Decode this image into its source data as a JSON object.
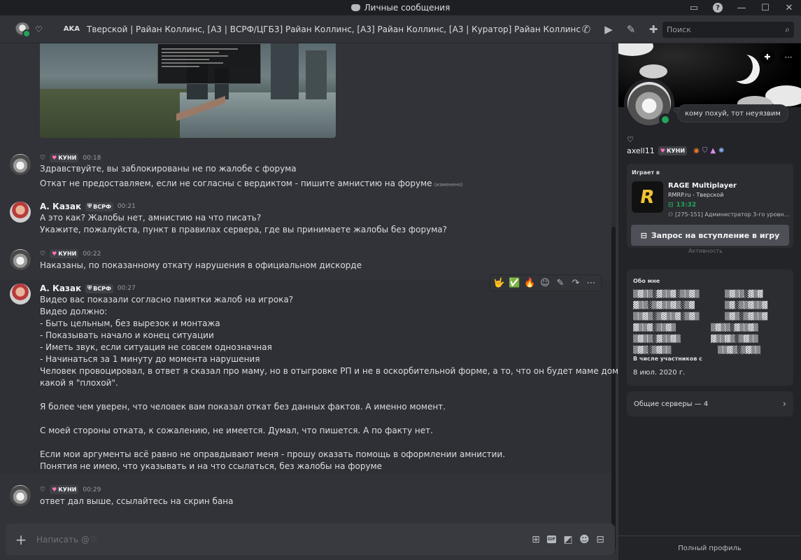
{
  "window": {
    "title": "Личные сообщения",
    "controls": [
      "inbox-icon",
      "help-icon",
      "minimize",
      "maximize",
      "close"
    ]
  },
  "header": {
    "heart": "♡",
    "aka_label": "AKA",
    "nicknames": "Тверской | Райан Коллинс, [А3 | ВСРФ/ЦГБ3] Райан Коллинс, [А3] Райан Коллинс, [А3 | Куратор] Райан Коллинс",
    "tools": [
      "phone-icon",
      "video-icon",
      "pin-icon",
      "add-member-icon",
      "profile-toggle-icon"
    ],
    "search_placeholder": "Поиск"
  },
  "messages": [
    {
      "author": "",
      "heart": "♡",
      "tag": "КУНИ",
      "time": "00:18",
      "lines": [
        "Здравствуйте, вы заблокированы не по жалобе с форума",
        "Откат не предоставляем, если не согласны с вердиктом - пишите амнистию на форуме"
      ],
      "edited": "(изменено)"
    },
    {
      "author": "А. Казак",
      "tag": "ВСРФ",
      "time": "00:21",
      "lines": [
        "А это как? Жалобы нет, амнистию на что писать?",
        "Укажите, пожалуйста, пункт в правилах сервера, где вы принимаете жалобы без форума?"
      ]
    },
    {
      "author": "",
      "heart": "♡",
      "tag": "КУНИ",
      "time": "00:22",
      "lines": [
        "Наказаны, по показанному откату нарушения в официальном дискорде"
      ]
    },
    {
      "author": "А. Казак",
      "tag": "ВСРФ",
      "time": "00:27",
      "lines": [
        "Видео вас показали согласно памятки жалоб на игрока?",
        "Видео должно:",
        "- Быть цельным, без вырезок и монтажа",
        "- Показывать начало и конец ситуации",
        "- Иметь звук, если ситуация не совсем однозначная",
        "- Начинаться за 1 минуту до момента нарушения",
        "Человек провоцировал, в ответ я сказал про маму, но в отыгровке РП и не в оскорбительной форме, а то, что он будет маме дома рассказывать",
        "какой я \"плохой\".",
        "Я более чем уверен, что человек вам показал откат без данных фактов. А именно момент.",
        "С моей стороны отката, к сожалению, не имеется. Думал, что пишется. А по факту нет.",
        "Если мои аргументы всё равно не оправдывают меня - прошу оказать помощь в оформлении амнистии.",
        "Понятия не имею, что указывать и на что ссылаться, без жалобы на форуме"
      ]
    },
    {
      "author": "",
      "heart": "♡",
      "tag": "КУНИ",
      "time": "00:29",
      "lines": [
        "ответ дал выше, ссылайтесь на скрин бана"
      ]
    }
  ],
  "message_actions": {
    "reactions": [
      "🤟",
      "✅",
      "🔥"
    ],
    "icons": [
      "add-reaction-icon",
      "edit-icon",
      "forward-icon",
      "more-icon"
    ]
  },
  "composer": {
    "placeholder": "Написать @♡",
    "tools": [
      "gift-icon",
      "gif-icon",
      "sticker-icon",
      "emoji-icon",
      "activity-icon"
    ],
    "gif_label": "GIF"
  },
  "profile": {
    "status_text": "кому похуй, тот неуязвим",
    "display_heart": "♡",
    "username": "axell11",
    "tag": "КУНИ",
    "activity": {
      "header": "Играет в",
      "game": "RAGE Multiplayer",
      "details": "RMRP.ru - Тверской",
      "elapsed": "13:32",
      "state": "[275-151] Администратор 3-го уровн...",
      "join_button": "Запрос на вступление в игру",
      "icon_letter": "R",
      "hidden_below": "Активность"
    },
    "about": {
      "title": "Обо мне",
      "member_since_title": "В числе участников с",
      "member_since": "8 июл. 2020 г."
    },
    "mutual_servers": "Общие серверы — 4",
    "full_profile": "Полный профиль"
  },
  "colors": {
    "background": "#313338",
    "sidebar": "#232428",
    "online": "#23a55a",
    "tag_heart": "#ff73b9",
    "game_icon": "#f1c232"
  }
}
